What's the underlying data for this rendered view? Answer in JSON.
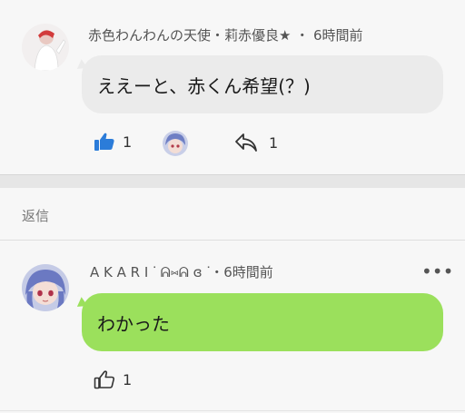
{
  "comment1": {
    "meta": "赤色わんわんの天使・莉赤優良★ ・ 6時間前",
    "message": "ええーと、赤くん希望(？)",
    "like_count": "1",
    "reply_count": "1",
    "like_color": "#2b7cd9",
    "bubble_color": "#ebebeb"
  },
  "replies_label": "返信",
  "comment2": {
    "meta": "A K A R I ᐝ ᕱ⑅ᕱ ɞ ᐝ・6時間前",
    "more": "•••",
    "message": "わかった",
    "like_count": "1",
    "bubble_color": "#9be05c"
  }
}
